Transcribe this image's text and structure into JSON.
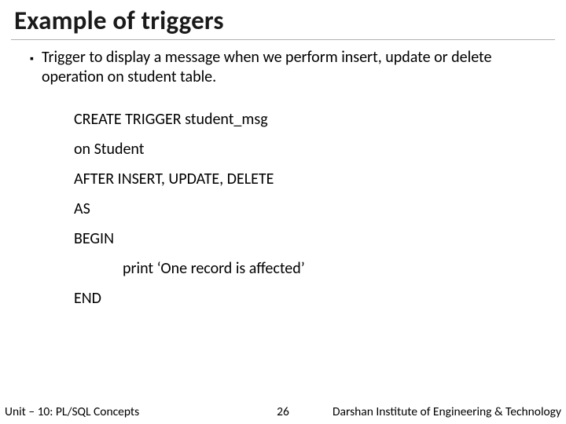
{
  "title": "Example of triggers",
  "bullet": {
    "marker": "▪",
    "text": "Trigger to display a message when we perform insert, update or delete operation on student table."
  },
  "code": {
    "line1": "CREATE TRIGGER student_msg",
    "line2": "on Student",
    "line3": "AFTER INSERT, UPDATE, DELETE",
    "line4": "AS",
    "line5": "BEGIN",
    "line6": "print ‘One record is affected’",
    "line7": "END"
  },
  "footer": {
    "left": "Unit – 10: PL/SQL Concepts",
    "center": "26",
    "right": "Darshan Institute of Engineering & Technology"
  }
}
